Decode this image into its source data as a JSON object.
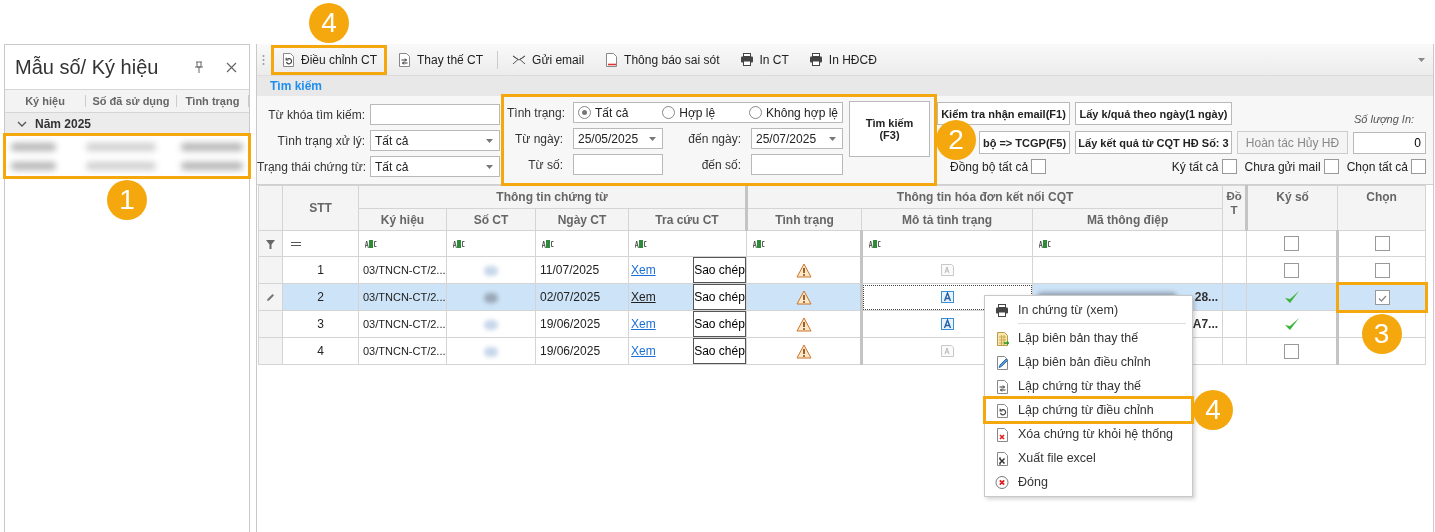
{
  "left_panel": {
    "title": "Mẫu số/ Ký hiệu",
    "columns": [
      "Ký hiệu",
      "Số đã sử dụng",
      "Tình trạng"
    ],
    "groups": [
      {
        "label": "Năm 2025",
        "expanded": true,
        "callout": "1",
        "rows": [
          {
            "kind": "redacted"
          },
          {
            "kind": "redacted"
          }
        ]
      }
    ]
  },
  "toolbar": {
    "items": [
      {
        "kind": "adjust",
        "label": "Điều chỉnh CT",
        "callout": "4"
      },
      {
        "kind": "replace",
        "label": "Thay thế CT"
      },
      {
        "kind": "separator"
      },
      {
        "kind": "email",
        "label": "Gửi email"
      },
      {
        "kind": "report",
        "label": "Thông báo sai sót"
      },
      {
        "kind": "print",
        "label": "In CT"
      },
      {
        "kind": "print",
        "label": "In HĐCĐ"
      }
    ]
  },
  "search": {
    "title": "Tìm kiếm",
    "fields": [
      {
        "kind": "text",
        "label": "Từ khóa tìm kiếm:"
      },
      {
        "kind": "select",
        "label": "Tình trạng xử lý:",
        "value": "Tất cả"
      },
      {
        "kind": "select",
        "label": "Trạng thái chứng từ:",
        "value": "Tất cả"
      }
    ],
    "filter": {
      "callout": "2",
      "status_label": "Tình trạng:",
      "status_options": [
        {
          "label": "Tất cả",
          "selected": true
        },
        {
          "label": "Hợp lệ",
          "selected": false
        },
        {
          "label": "Không hợp lệ",
          "selected": false
        }
      ],
      "from_date_label": "Từ ngày:",
      "from_date": "25/05/2025",
      "to_date_label": "đến ngày:",
      "to_date": "25/07/2025",
      "from_no_label": "Từ số:",
      "to_no_label": "đến số:"
    },
    "search_button": "Tìm kiếm (F3)",
    "actions": [
      {
        "label": "Kiểm tra nhận email(F1)",
        "disabled": false
      },
      {
        "label": "Lấy k/quả theo ngày(1 ngày)",
        "disabled": false
      },
      {
        "label": "bộ => TCGP(F5)",
        "disabled": false
      },
      {
        "label": "Lấy kết quả từ CQT HĐ Số: 3",
        "disabled": false
      },
      {
        "label": "Hoàn tác Hủy HĐ",
        "disabled": true
      }
    ],
    "print_count": {
      "label": "Số lượng In:",
      "value": "0"
    },
    "toggles": [
      {
        "label": "Đồng bộ tất cả",
        "checked": false
      },
      {
        "label": "Ký tất cả",
        "checked": false
      },
      {
        "label": "Chưa gửi mail",
        "checked": false
      },
      {
        "label": "Chọn tất cả",
        "checked": false
      }
    ]
  },
  "grid": {
    "columns": [
      {
        "label": "STT"
      },
      {
        "label": "Thông tin chứng từ",
        "children": [
          {
            "label": "Ký hiệu"
          },
          {
            "label": "Số CT"
          },
          {
            "label": "Ngày CT"
          },
          {
            "label": "Tra cứu CT"
          }
        ]
      },
      {
        "label": "Thông tin hóa đơn kết nối CQT",
        "children": [
          {
            "label": "Tình trạng"
          },
          {
            "label": "Mô tả tình trạng"
          },
          {
            "label": "Mã thông điệp"
          }
        ]
      },
      {
        "label": "Đồ T"
      },
      {
        "label": "Ký số",
        "filter_checked": false
      },
      {
        "label": "Chọn",
        "filter_checked": false
      }
    ],
    "rows": [
      {
        "stt": "1",
        "ky_hieu": "03/TNCN-CT/2...",
        "ngay_ct": "11/07/2025",
        "link": "Xem",
        "copy": "Sao chép",
        "warning": true,
        "description_filled": false,
        "signed": false,
        "chosen": false,
        "selected": false
      },
      {
        "stt": "2",
        "ky_hieu": "03/TNCN-CT/2...",
        "ngay_ct": "02/07/2025",
        "link": "Xem",
        "copy": "Sao chép",
        "warning": true,
        "description_filled": true,
        "message": "28...",
        "message_redacted": true,
        "signed": true,
        "chosen": true,
        "selected": true,
        "chosen_callout": "3"
      },
      {
        "stt": "3",
        "ky_hieu": "03/TNCN-CT/2...",
        "ngay_ct": "19/06/2025",
        "link": "Xem",
        "copy": "Sao chép",
        "warning": true,
        "description_filled": true,
        "message": "A7...",
        "signed": true,
        "selected": false
      },
      {
        "stt": "4",
        "ky_hieu": "03/TNCN-CT/2...",
        "ngay_ct": "19/06/2025",
        "link": "Xem",
        "copy": "Sao chép",
        "warning": true,
        "description_filled": false,
        "signed": false,
        "selected": false
      }
    ]
  },
  "context_menu": {
    "items": [
      {
        "kind": "print",
        "label": "In chứng từ (xem)"
      },
      {
        "kind": "separator"
      },
      {
        "kind": "sheet",
        "label": "Lập biên bản thay thế"
      },
      {
        "kind": "pen",
        "label": "Lập biên bản điều chỉnh"
      },
      {
        "kind": "replace",
        "label": "Lập chứng từ thay thế"
      },
      {
        "kind": "adjust",
        "label": "Lập chứng từ điều chỉnh",
        "callout": "4"
      },
      {
        "kind": "delete",
        "label": "Xóa chứng từ khỏi hệ thống"
      },
      {
        "kind": "excel",
        "label": "Xuất file excel"
      },
      {
        "kind": "close",
        "label": "Đóng"
      }
    ]
  }
}
